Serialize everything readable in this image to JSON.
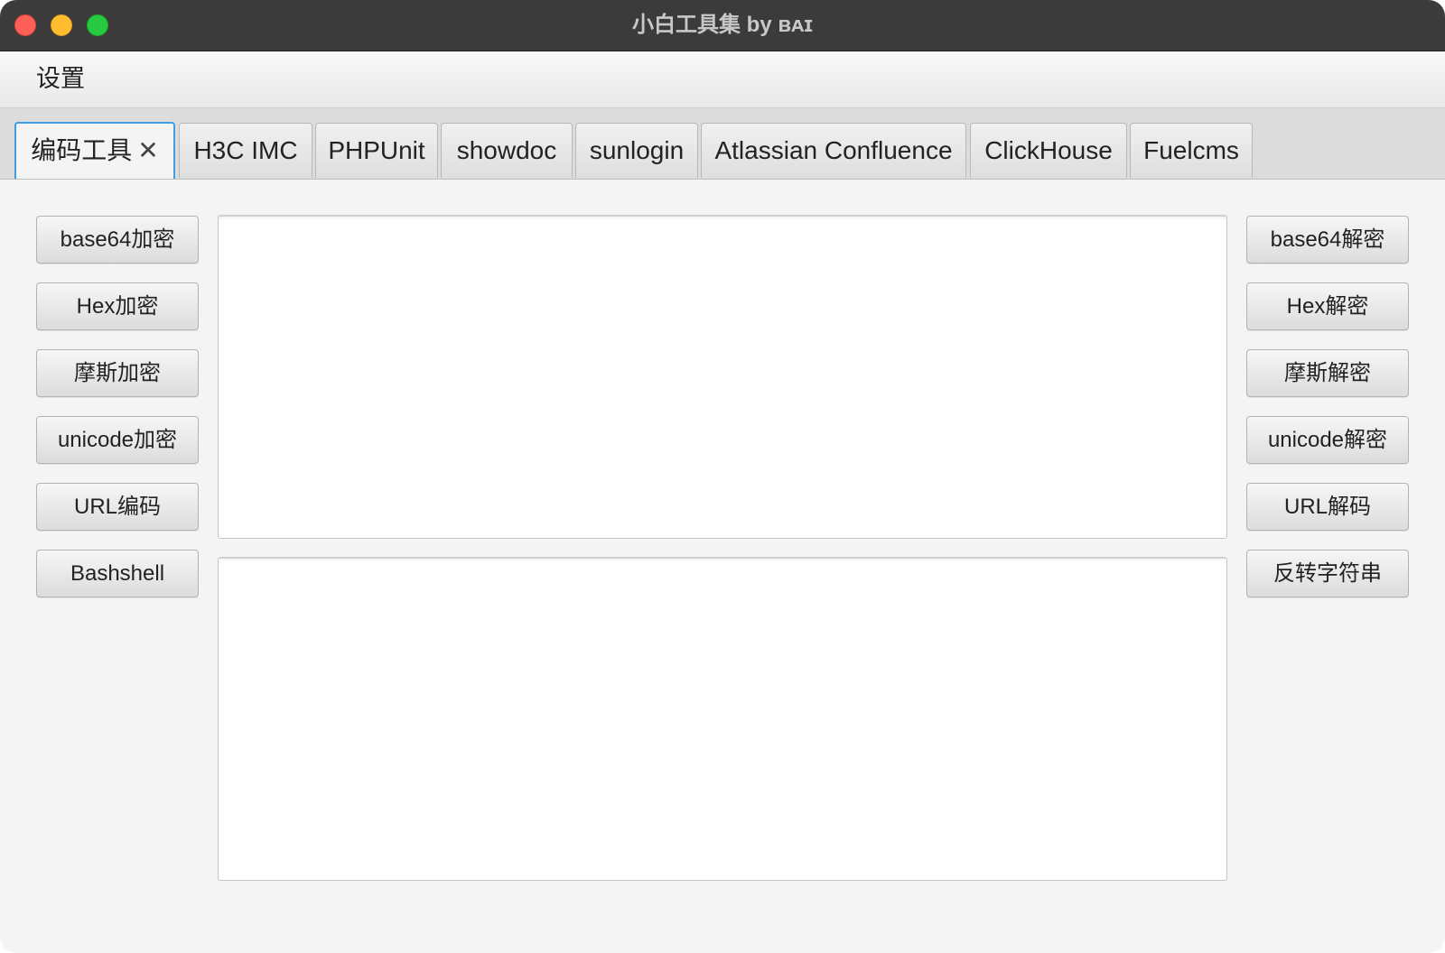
{
  "window": {
    "title": "小白工具集  by ʙᴀɪ"
  },
  "menubar": {
    "items": [
      "设置"
    ]
  },
  "tabs": [
    {
      "label": "编码工具",
      "active": true,
      "closable": true
    },
    {
      "label": "H3C IMC"
    },
    {
      "label": "PHPUnit"
    },
    {
      "label": "showdoc"
    },
    {
      "label": "sunlogin"
    },
    {
      "label": "Atlassian Confluence"
    },
    {
      "label": "ClickHouse"
    },
    {
      "label": "Fuelcms"
    }
  ],
  "left_buttons": [
    "base64加密",
    "Hex加密",
    "摩斯加密",
    "unicode加密",
    "URL编码",
    "Bashshell"
  ],
  "right_buttons": [
    "base64解密",
    "Hex解密",
    "摩斯解密",
    "unicode解密",
    "URL解码",
    "反转字符串"
  ],
  "input_area": {
    "value": ""
  },
  "output_area": {
    "value": ""
  },
  "colors": {
    "titlebar": "#3b3b3b",
    "active_tab_border": "#3d9ee6",
    "close_button": "#fe5f57",
    "minimize_button": "#febc2e",
    "maximize_button": "#28c840"
  }
}
